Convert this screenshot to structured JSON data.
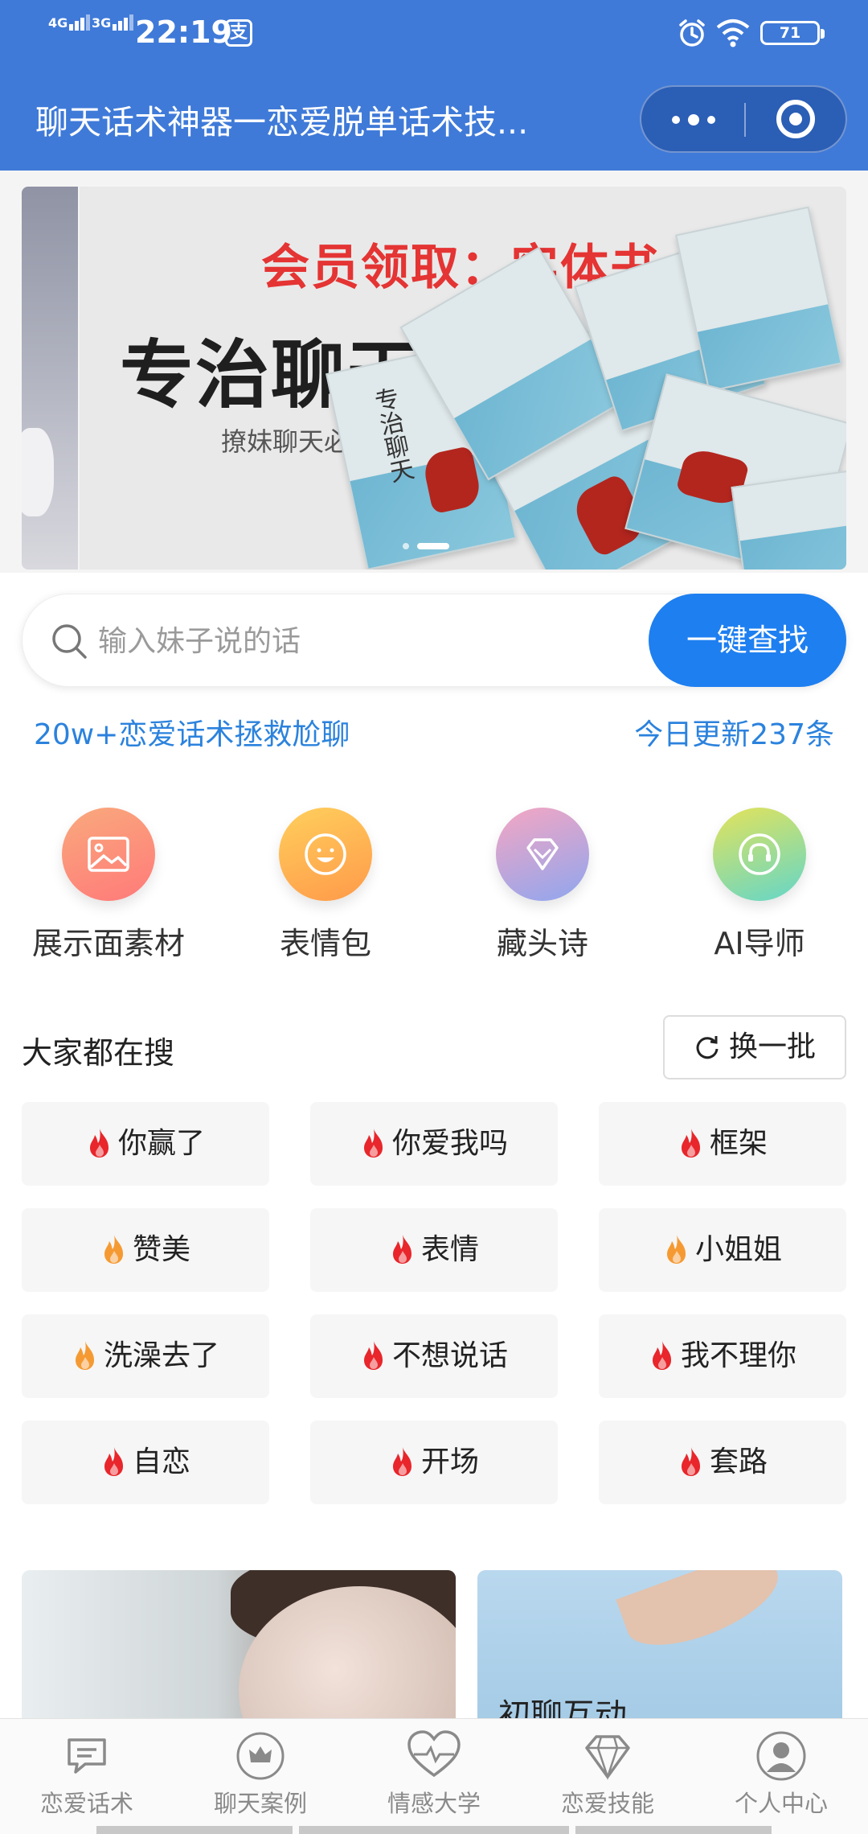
{
  "status_bar": {
    "signal1": "4G",
    "signal2": "3G",
    "time": "22:19",
    "pay_glyph": "支",
    "battery": "71"
  },
  "title_bar": {
    "title": "聊天话术神器一恋爱脱单话术技...",
    "icons": [
      "more-icon",
      "close-mini-program-icon"
    ]
  },
  "banner": {
    "headline_red": "会员领取：实体书一本",
    "headline": "专治聊天话术",
    "subline": "撩妹聊天必备",
    "book_title": "专治聊天",
    "active_slide": 2,
    "slide_count": 2
  },
  "search": {
    "placeholder": "输入妹子说的话",
    "button": "一键查找"
  },
  "taglines": {
    "left": "20w+恋爱话术拯救尬聊",
    "right": "今日更新237条"
  },
  "quick_icons": [
    {
      "label": "展示面素材",
      "icon": "image-icon",
      "color_from": "#f9a97c",
      "color_to": "#ff7a7a"
    },
    {
      "label": "表情包",
      "icon": "smile-icon",
      "color_from": "#ffcf5c",
      "color_to": "#ff9a4a"
    },
    {
      "label": "藏头诗",
      "icon": "diamond-icon",
      "color_from": "#f5a6c2",
      "color_to": "#8fa6ef"
    },
    {
      "label": "AI导师",
      "icon": "headset-icon",
      "color_from": "#e4e35a",
      "color_to": "#63d6c9"
    }
  ],
  "hot": {
    "title": "大家都在搜",
    "refresh": "换一批",
    "chips": [
      {
        "text": "你赢了",
        "fire": "red"
      },
      {
        "text": "你爱我吗",
        "fire": "red"
      },
      {
        "text": "框架",
        "fire": "red"
      },
      {
        "text": "赞美",
        "fire": "orange"
      },
      {
        "text": "表情",
        "fire": "red"
      },
      {
        "text": "小姐姐",
        "fire": "orange"
      },
      {
        "text": "洗澡去了",
        "fire": "orange"
      },
      {
        "text": "不想说话",
        "fire": "red"
      },
      {
        "text": "我不理你",
        "fire": "red"
      },
      {
        "text": "自恋",
        "fire": "red"
      },
      {
        "text": "开场",
        "fire": "red"
      },
      {
        "text": "套路",
        "fire": "red"
      }
    ]
  },
  "cards": {
    "right_title": "初聊互动"
  },
  "tabbar": {
    "items": [
      {
        "label": "恋爱话术",
        "icon": "chat-bubble-icon"
      },
      {
        "label": "聊天案例",
        "icon": "crown-icon"
      },
      {
        "label": "情感大学",
        "icon": "heartbeat-icon"
      },
      {
        "label": "恋爱技能",
        "icon": "diamond-icon"
      },
      {
        "label": "个人中心",
        "icon": "user-icon"
      }
    ]
  },
  "colors": {
    "header": "#3f7ad8",
    "accent": "#1e7ff0",
    "tagline": "#2b82dd",
    "fire_red": "#e8262b",
    "fire_orange": "#f59a33"
  }
}
